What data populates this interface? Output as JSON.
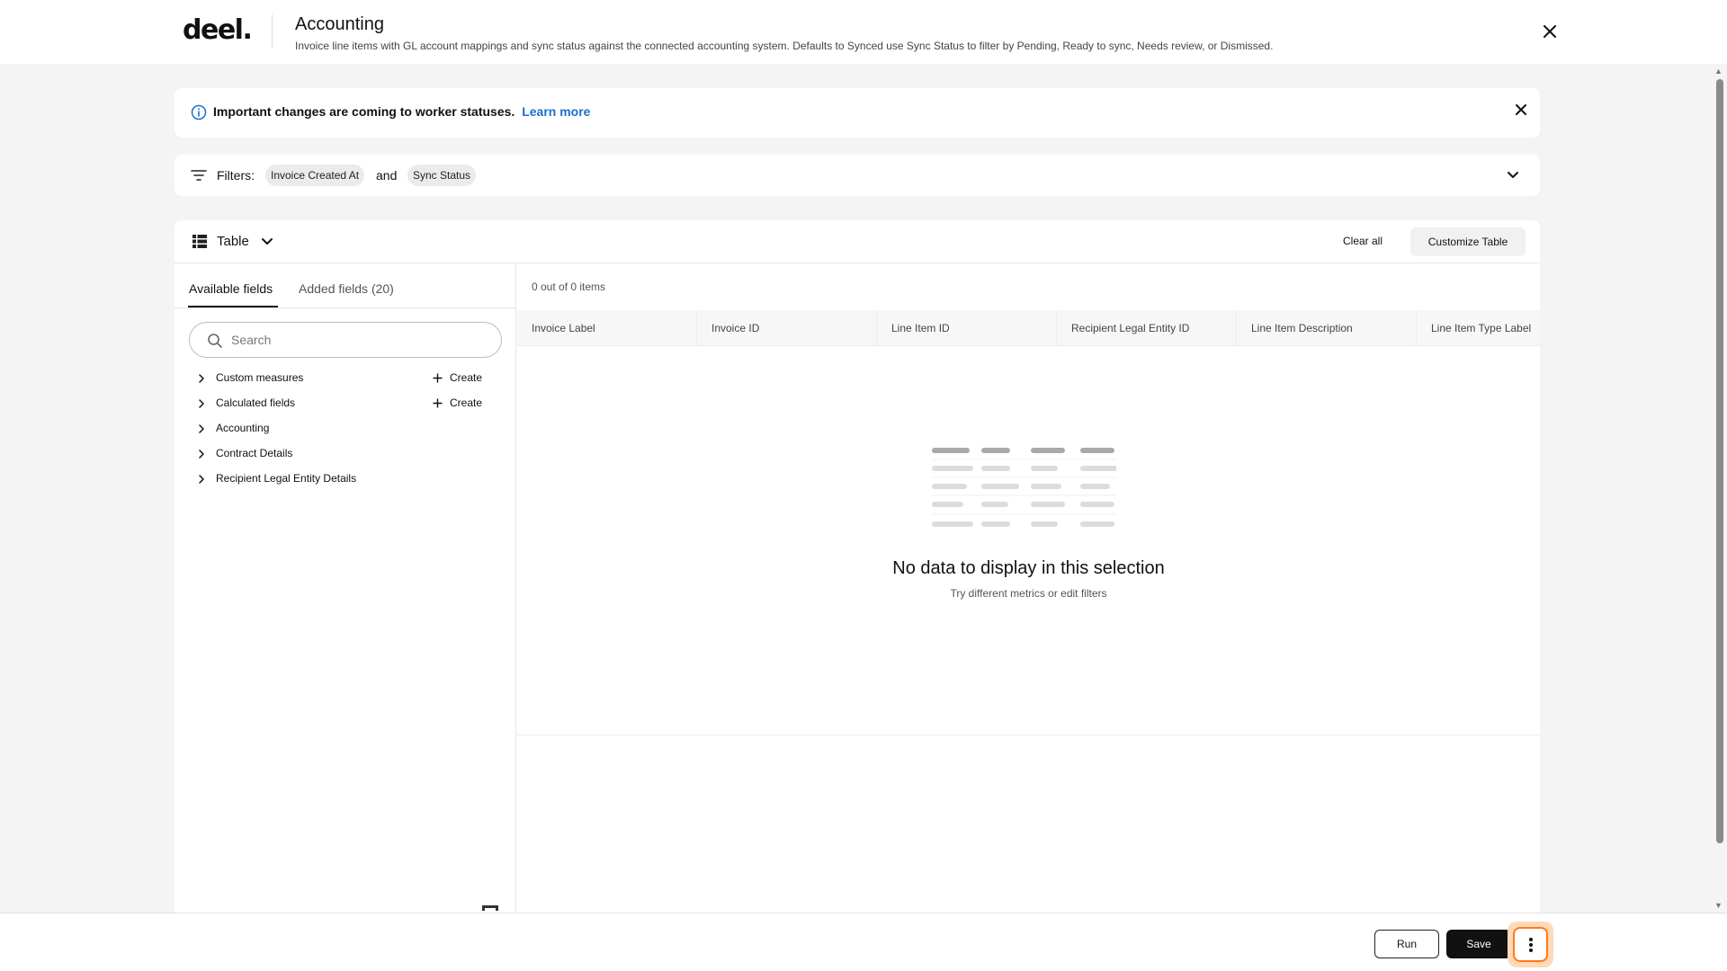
{
  "header": {
    "logo": "deel.",
    "title": "Accounting",
    "subtitle": "Invoice line items with GL account mappings and sync status against the connected accounting system. Defaults to Synced use Sync Status to filter by Pending, Ready to sync, Needs review, or Dismissed."
  },
  "banner": {
    "text": "Important changes are coming to worker statuses.",
    "link": "Learn more"
  },
  "filters": {
    "label": "Filters:",
    "chips": [
      "Invoice Created At",
      "Sync Status"
    ],
    "connector": "and"
  },
  "toolbar": {
    "view_label": "Table",
    "clear_all": "Clear all",
    "customize": "Customize Table"
  },
  "fields_panel": {
    "tabs": [
      "Available fields",
      "Added fields (20)"
    ],
    "search_placeholder": "Search",
    "create_label": "Create",
    "items": [
      {
        "label": "Custom measures"
      },
      {
        "label": "Calculated fields"
      },
      {
        "label": "Accounting"
      },
      {
        "label": "Contract Details"
      },
      {
        "label": "Recipient Legal Entity Details"
      }
    ]
  },
  "table": {
    "count": "0 out of 0 items",
    "columns": [
      "Invoice Label",
      "Invoice ID",
      "Line Item ID",
      "Recipient Legal Entity ID",
      "Line Item Description",
      "Line Item Type Label"
    ],
    "empty_title": "No data to display in this selection",
    "empty_subtitle": "Try different metrics or edit filters"
  },
  "footer": {
    "run": "Run",
    "save": "Save"
  },
  "colors": {
    "accent_link": "#1a6fcf",
    "primary_button": "#111111",
    "focus_ring": "#ff7a1a"
  }
}
